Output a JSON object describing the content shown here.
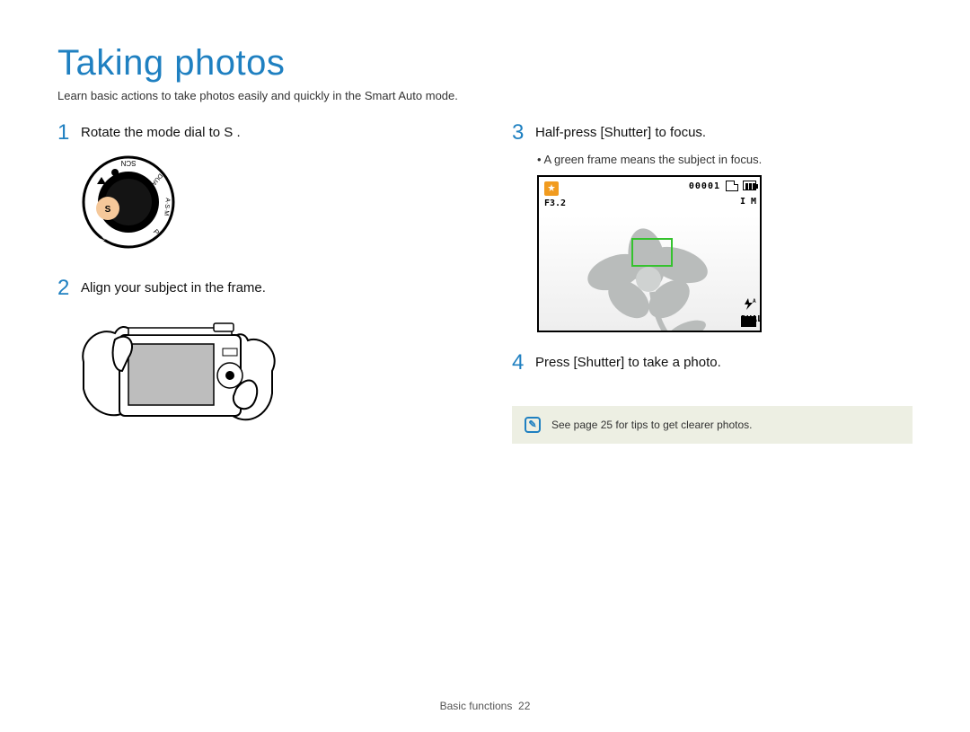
{
  "title": "Taking photos",
  "intro": "Learn basic actions to take photos easily and quickly in the Smart Auto mode.",
  "steps": {
    "s1": {
      "num": "1",
      "text": "Rotate the mode dial to S ."
    },
    "s2": {
      "num": "2",
      "text": "Align your subject in the frame."
    },
    "s3": {
      "num": "3",
      "text": "Half-press [Shutter] to focus."
    },
    "s3_bullet": "A green frame means the subject in focus.",
    "s4": {
      "num": "4",
      "text": "Press [Shutter] to take a photo."
    }
  },
  "lcd": {
    "aperture": "F3.2",
    "counter": "00001",
    "img_size": "I M",
    "stab": "DUAL"
  },
  "note": "See page 25 for tips to get clearer photos.",
  "footer_section": "Basic functions",
  "footer_page": "22",
  "icons": {
    "mode_dial": "mode-dial-icon",
    "camera_hold": "camera-hold-icon",
    "flower_scene": "scene-flower-icon",
    "note": "note-icon"
  }
}
